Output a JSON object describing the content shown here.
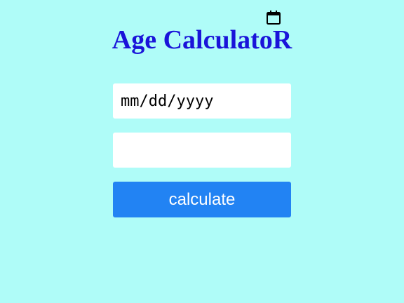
{
  "app": {
    "title": "Age CalculatoR"
  },
  "form": {
    "date_input": {
      "placeholder": "mm/dd/yyyy",
      "value": ""
    },
    "result_field": {
      "value": ""
    },
    "calculate_label": "calculate"
  },
  "icons": {
    "date_picker": "calendar-icon"
  },
  "colors": {
    "background": "#affcf8",
    "title": "#1a14d9",
    "button": "#2283f3",
    "button_text": "#ffffff",
    "field_background": "#ffffff"
  }
}
